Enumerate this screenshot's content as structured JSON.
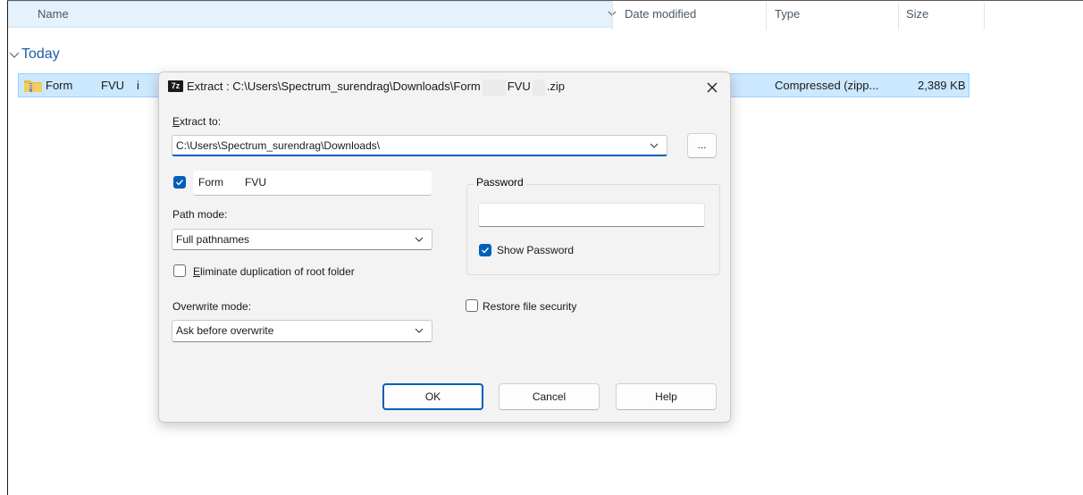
{
  "explorer": {
    "columns": {
      "name": "Name",
      "date_modified": "Date modified",
      "type": "Type",
      "size": "Size"
    },
    "group": "Today",
    "file_row": {
      "name_part1": "Form",
      "name_part2": "FVU",
      "name_part3": "i",
      "type": "Compressed (zipp...",
      "size": "2,389 KB"
    }
  },
  "dialog": {
    "app_icon_text": "7z",
    "title_prefix": "Extract : C:\\Users\\Spectrum_surendrag\\Downloads\\Form",
    "title_mid": "FVU",
    "title_suffix": ".zip",
    "extract_to_label_accel": "E",
    "extract_to_label_rest": "xtract to:",
    "extract_to_value": "C:\\Users\\Spectrum_surendrag\\Downloads\\",
    "browse_label": "...",
    "folder_name_part1": "Form",
    "folder_name_part2": "FVU",
    "path_mode_label": "Path mode:",
    "path_mode_value": "Full pathnames",
    "eliminate_label_accel": "E",
    "eliminate_label_rest": "liminate duplication of root folder",
    "overwrite_mode_label": "Overwrite mode:",
    "overwrite_mode_value": "Ask before overwrite",
    "password_group_label": "Password",
    "password_value": "",
    "show_password_label": "Show Password",
    "restore_security_label": "Restore file security",
    "ok_label": "OK",
    "cancel_label": "Cancel",
    "help_label": "Help",
    "checkbox_states": {
      "folder_name": true,
      "show_password": true,
      "eliminate_duplication": false,
      "restore_security": false
    }
  },
  "colors": {
    "accent": "#005fb8",
    "selection": "#cce8ff",
    "header_highlight": "#e5f1fb",
    "group_text": "#1e5ba8"
  }
}
